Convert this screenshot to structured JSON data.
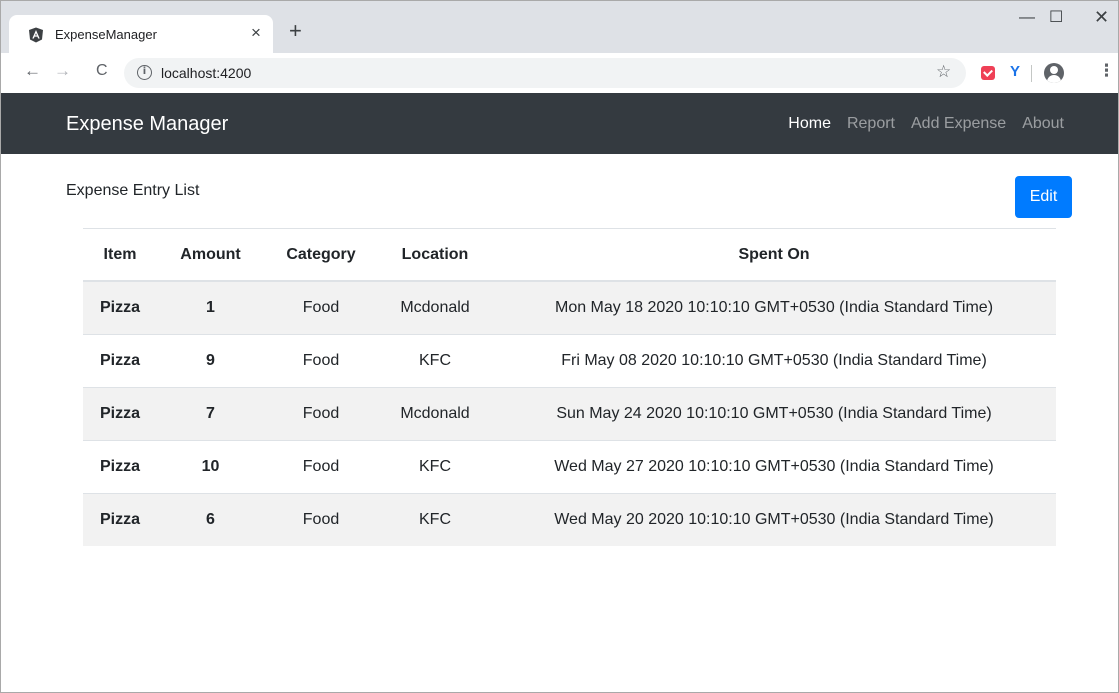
{
  "browser": {
    "tab_title": "ExpenseManager",
    "tab_close": "×",
    "new_tab": "+",
    "url": "localhost:4200",
    "window_controls": {
      "minimize": "—",
      "maximize": "☐",
      "close": "✕"
    },
    "icons": [
      "angular-favicon-icon",
      "back-arrow-icon",
      "forward-arrow-icon",
      "reload-icon",
      "info-icon",
      "star-icon",
      "pocket-extension-icon",
      "y-extension-icon",
      "profile-icon",
      "menu-icon"
    ]
  },
  "navbar": {
    "brand": "Expense Manager",
    "links": [
      {
        "label": "Home",
        "active": true
      },
      {
        "label": "Report",
        "active": false
      },
      {
        "label": "Add Expense",
        "active": false
      },
      {
        "label": "About",
        "active": false
      }
    ],
    "background": "#343a40"
  },
  "main": {
    "heading": "Expense Entry List",
    "edit_label": "Edit",
    "accent": "#007bff"
  },
  "table": {
    "headers": [
      "Item",
      "Amount",
      "Category",
      "Location",
      "Spent On"
    ],
    "rows": [
      [
        "Pizza",
        "1",
        "Food",
        "Mcdonald",
        "Mon May 18 2020 10:10:10 GMT+0530 (India Standard Time)"
      ],
      [
        "Pizza",
        "9",
        "Food",
        "KFC",
        "Fri May 08 2020 10:10:10 GMT+0530 (India Standard Time)"
      ],
      [
        "Pizza",
        "7",
        "Food",
        "Mcdonald",
        "Sun May 24 2020 10:10:10 GMT+0530 (India Standard Time)"
      ],
      [
        "Pizza",
        "10",
        "Food",
        "KFC",
        "Wed May 27 2020 10:10:10 GMT+0530 (India Standard Time)"
      ],
      [
        "Pizza",
        "6",
        "Food",
        "KFC",
        "Wed May 20 2020 10:10:10 GMT+0530 (India Standard Time)"
      ]
    ]
  }
}
